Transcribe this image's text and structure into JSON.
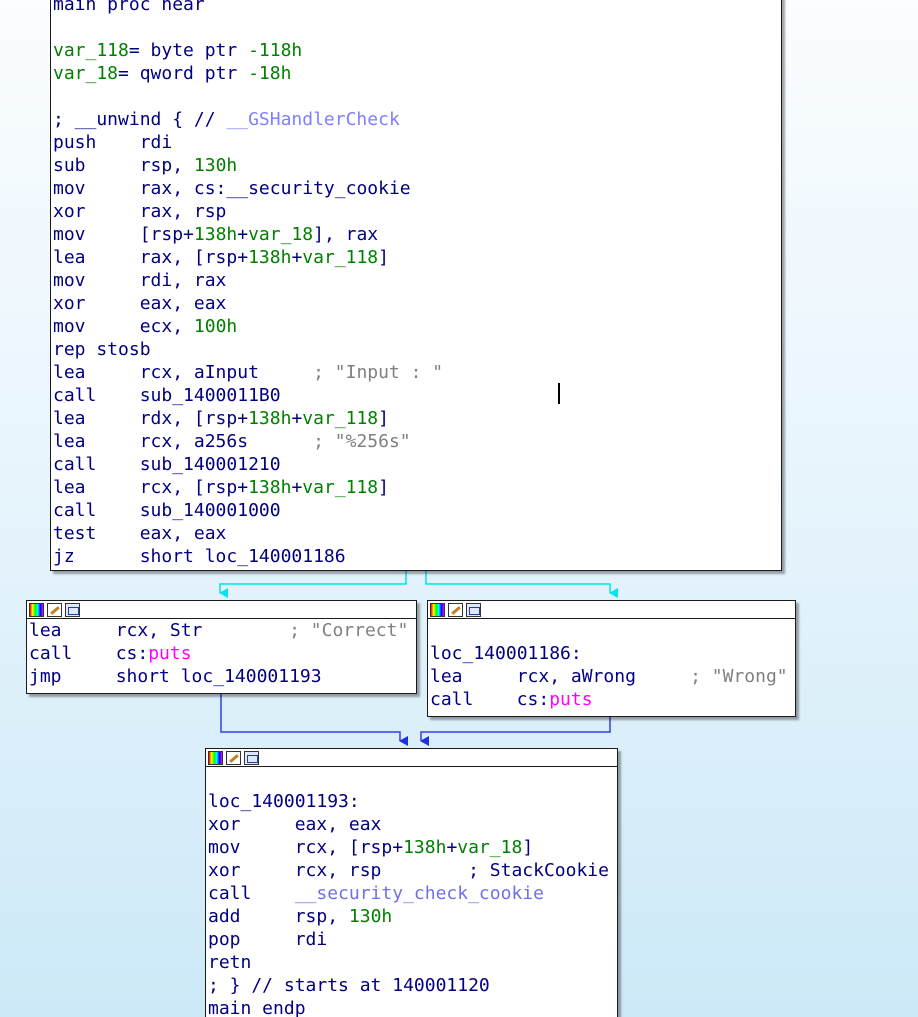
{
  "main_block": {
    "lines": [
      [
        {
          "t": "main proc near",
          "c": "lbl"
        }
      ],
      [],
      [
        {
          "t": "var_118",
          "c": "var"
        },
        {
          "t": "= byte ptr ",
          "c": "op"
        },
        {
          "t": "-118h",
          "c": "num"
        }
      ],
      [
        {
          "t": "var_18",
          "c": "var"
        },
        {
          "t": "= qword ptr ",
          "c": "op"
        },
        {
          "t": "-18h",
          "c": "num"
        }
      ],
      [],
      [
        {
          "t": "; __unwind { // ",
          "c": "unw"
        },
        {
          "t": "__GSHandlerCheck",
          "c": "gs"
        }
      ],
      [
        {
          "t": "push    ",
          "c": "mn"
        },
        {
          "t": "rdi",
          "c": "op"
        }
      ],
      [
        {
          "t": "sub     ",
          "c": "mn"
        },
        {
          "t": "rsp, ",
          "c": "op"
        },
        {
          "t": "130h",
          "c": "num"
        }
      ],
      [
        {
          "t": "mov     ",
          "c": "mn"
        },
        {
          "t": "rax, cs:__security_cookie",
          "c": "op"
        }
      ],
      [
        {
          "t": "xor     ",
          "c": "mn"
        },
        {
          "t": "rax, rsp",
          "c": "op"
        }
      ],
      [
        {
          "t": "mov     ",
          "c": "mn"
        },
        {
          "t": "[rsp+",
          "c": "op"
        },
        {
          "t": "138h",
          "c": "num"
        },
        {
          "t": "+",
          "c": "op"
        },
        {
          "t": "var_18",
          "c": "var"
        },
        {
          "t": "], rax",
          "c": "op"
        }
      ],
      [
        {
          "t": "lea     ",
          "c": "mn"
        },
        {
          "t": "rax, [rsp+",
          "c": "op"
        },
        {
          "t": "138h",
          "c": "num"
        },
        {
          "t": "+",
          "c": "op"
        },
        {
          "t": "var_118",
          "c": "var"
        },
        {
          "t": "]",
          "c": "op"
        }
      ],
      [
        {
          "t": "mov     ",
          "c": "mn"
        },
        {
          "t": "rdi, rax",
          "c": "op"
        }
      ],
      [
        {
          "t": "xor     ",
          "c": "mn"
        },
        {
          "t": "eax, eax",
          "c": "op"
        }
      ],
      [
        {
          "t": "mov     ",
          "c": "mn"
        },
        {
          "t": "ecx, ",
          "c": "op"
        },
        {
          "t": "100h",
          "c": "num"
        }
      ],
      [
        {
          "t": "rep stosb",
          "c": "mn"
        }
      ],
      [
        {
          "t": "lea     ",
          "c": "mn"
        },
        {
          "t": "rcx, aInput     ",
          "c": "op"
        },
        {
          "t": "; \"Input : \"",
          "c": "str"
        }
      ],
      [
        {
          "t": "call    ",
          "c": "mn"
        },
        {
          "t": "sub_1400011B0",
          "c": "op"
        }
      ],
      [
        {
          "t": "lea     ",
          "c": "mn"
        },
        {
          "t": "rdx, [rsp+",
          "c": "op"
        },
        {
          "t": "138h",
          "c": "num"
        },
        {
          "t": "+",
          "c": "op"
        },
        {
          "t": "var_118",
          "c": "var"
        },
        {
          "t": "]",
          "c": "op"
        }
      ],
      [
        {
          "t": "lea     ",
          "c": "mn"
        },
        {
          "t": "rcx, a256s      ",
          "c": "op"
        },
        {
          "t": "; \"%256s\"",
          "c": "str"
        }
      ],
      [
        {
          "t": "call    ",
          "c": "mn"
        },
        {
          "t": "sub_140001210",
          "c": "op"
        }
      ],
      [
        {
          "t": "lea     ",
          "c": "mn"
        },
        {
          "t": "rcx, [rsp+",
          "c": "op"
        },
        {
          "t": "138h",
          "c": "num"
        },
        {
          "t": "+",
          "c": "op"
        },
        {
          "t": "var_118",
          "c": "var"
        },
        {
          "t": "]",
          "c": "op"
        }
      ],
      [
        {
          "t": "call    ",
          "c": "mn"
        },
        {
          "t": "sub_140001000",
          "c": "op"
        }
      ],
      [
        {
          "t": "test    ",
          "c": "mn"
        },
        {
          "t": "eax, eax",
          "c": "op"
        }
      ],
      [
        {
          "t": "jz      ",
          "c": "mn"
        },
        {
          "t": "short loc_140001186",
          "c": "op"
        }
      ]
    ]
  },
  "correct_block": {
    "lines": [
      [
        {
          "t": "lea     ",
          "c": "mn"
        },
        {
          "t": "rcx, Str        ",
          "c": "op"
        },
        {
          "t": "; \"Correct\"",
          "c": "str"
        }
      ],
      [
        {
          "t": "call    ",
          "c": "mn"
        },
        {
          "t": "cs:",
          "c": "op"
        },
        {
          "t": "puts",
          "c": "imp"
        }
      ],
      [
        {
          "t": "jmp     ",
          "c": "mn"
        },
        {
          "t": "short loc_140001193",
          "c": "op"
        }
      ]
    ]
  },
  "wrong_block": {
    "lines": [
      [],
      [
        {
          "t": "loc_140001186:",
          "c": "lbl"
        }
      ],
      [
        {
          "t": "lea     ",
          "c": "mn"
        },
        {
          "t": "rcx, aWrong     ",
          "c": "op"
        },
        {
          "t": "; \"Wrong\"",
          "c": "str"
        }
      ],
      [
        {
          "t": "call    ",
          "c": "mn"
        },
        {
          "t": "cs:",
          "c": "op"
        },
        {
          "t": "puts",
          "c": "imp"
        }
      ]
    ]
  },
  "end_block": {
    "lines": [
      [],
      [
        {
          "t": "loc_140001193:",
          "c": "lbl"
        }
      ],
      [
        {
          "t": "xor     ",
          "c": "mn"
        },
        {
          "t": "eax, eax",
          "c": "op"
        }
      ],
      [
        {
          "t": "mov     ",
          "c": "mn"
        },
        {
          "t": "rcx, [rsp+",
          "c": "op"
        },
        {
          "t": "138h",
          "c": "num"
        },
        {
          "t": "+",
          "c": "op"
        },
        {
          "t": "var_18",
          "c": "var"
        },
        {
          "t": "]",
          "c": "op"
        }
      ],
      [
        {
          "t": "xor     ",
          "c": "mn"
        },
        {
          "t": "rcx, rsp        ",
          "c": "op"
        },
        {
          "t": "; StackCookie",
          "c": "unw"
        }
      ],
      [
        {
          "t": "call    ",
          "c": "mn"
        },
        {
          "t": "__security_check_cookie",
          "c": "sc"
        }
      ],
      [
        {
          "t": "add     ",
          "c": "mn"
        },
        {
          "t": "rsp, ",
          "c": "op"
        },
        {
          "t": "130h",
          "c": "num"
        }
      ],
      [
        {
          "t": "pop     ",
          "c": "mn"
        },
        {
          "t": "rdi",
          "c": "op"
        }
      ],
      [
        {
          "t": "retn",
          "c": "mn"
        }
      ],
      [
        {
          "t": "; } // starts at 140001120",
          "c": "unw"
        }
      ],
      [
        {
          "t": "main endp",
          "c": "lbl"
        }
      ]
    ]
  },
  "header_icons": [
    "color-palette-icon",
    "edit-icon",
    "graph-icon"
  ],
  "colors": {
    "branch_edge": "#00e5ee",
    "flow_edge": "#3040e0"
  }
}
